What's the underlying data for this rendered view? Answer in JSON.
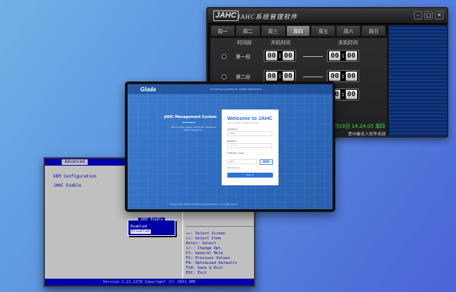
{
  "schedule": {
    "logo": "JAHC",
    "app_title": "JAHC系统管理软件",
    "window_buttons": [
      "–",
      "□",
      "✕"
    ],
    "tabs": [
      "周一",
      "周二",
      "周三",
      "周四",
      "周五",
      "周六",
      "周日"
    ],
    "active_tab": 3,
    "col_period": "时间段",
    "col_on": "开机时间",
    "col_off": "关机时间",
    "rows": [
      {
        "label": "第一段",
        "on": [
          "00",
          "00"
        ],
        "off": [
          "00",
          "00"
        ]
      },
      {
        "label": "第二段",
        "on": [
          "00",
          "00"
        ],
        "off": [
          "00",
          "00"
        ]
      },
      {
        "label": "",
        "on": [
          "",
          ""
        ],
        "off": [
          "00",
          "00"
        ]
      }
    ],
    "status_date": "月03日",
    "status_time": "14:24:05",
    "status_day": "周四",
    "status_footer": "贵州秦无人软件系统"
  },
  "login": {
    "brand": "Glada",
    "tagline": "Connecting everything for a better digital future",
    "left_title": "JAHC Management System",
    "left_text": "JAHC is a highly reliable, user-friendly management system designed for...",
    "welcome": "Welcome to JAHC",
    "welcome_sub": "Sign in to JAHC Management System",
    "username_label": "UserName",
    "username_placeholder": "admin",
    "password_label": "Password",
    "password_value": "••••••••",
    "verify_label": "Verification Code",
    "verify_value": "0026",
    "captcha": "H0D5",
    "remember": "Remember me",
    "signin": "Sign in",
    "copyright": "Copyright ©2021 Shenzhen Glada Technology Development Co., Ltd. All rights reserved."
  },
  "bios": {
    "tab": "Advanced",
    "section": "OEM Configuration",
    "item": "JAHC Enable",
    "popup_title": "JAHC Enable",
    "options": [
      "Enabled",
      "Disabled"
    ],
    "selected_option": 1,
    "keys": [
      "→←: Select Screen",
      "↑↓: Select Item",
      "Enter: Select",
      "+/-: Change Opt.",
      "F1: General Help",
      "F2: Previous Values",
      "F9: Optimized Defaults",
      "F10: Save & Exit",
      "ESC: Exit"
    ],
    "footer": "Version 2.21.1278 Copyright (C) 2021 AMI"
  }
}
